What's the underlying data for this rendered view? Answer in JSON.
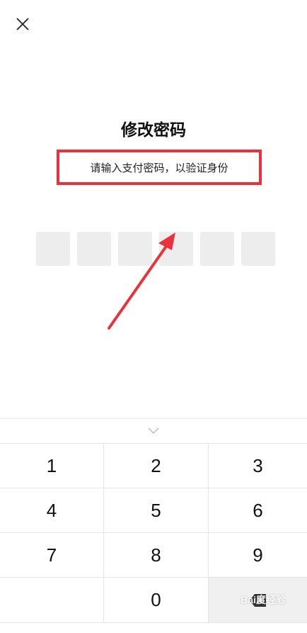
{
  "header": {
    "close_icon": "close-icon",
    "title": "修改密码",
    "subtitle": "请输入支付密码，以验证身份"
  },
  "pin": {
    "length": 6,
    "filled": 0
  },
  "annotation": {
    "highlight_color": "#e8323c"
  },
  "keyboard": {
    "collapse_icon": "chevron-down-icon",
    "keys": [
      "1",
      "2",
      "3",
      "4",
      "5",
      "6",
      "7",
      "8",
      "9",
      "",
      "0",
      "delete"
    ],
    "delete_icon": "backspace-icon"
  },
  "watermark": "Bai度经验"
}
